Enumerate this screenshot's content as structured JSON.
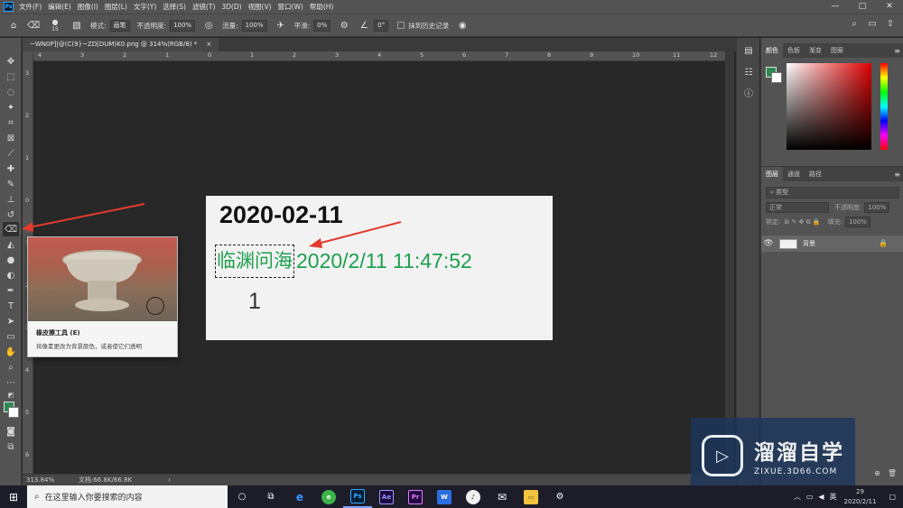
{
  "app": {
    "menu": [
      "文件(F)",
      "编辑(E)",
      "图像(I)",
      "图层(L)",
      "文字(Y)",
      "选择(S)",
      "滤镜(T)",
      "3D(D)",
      "视图(V)",
      "窗口(W)",
      "帮助(H)"
    ],
    "window_controls": [
      "—",
      "□",
      "✕"
    ]
  },
  "options_bar": {
    "brush_size": "15",
    "mode_label": "模式:",
    "mode_value": "画笔",
    "opacity_label": "不透明度:",
    "opacity_value": "100%",
    "flow_label": "流量:",
    "flow_value": "100%",
    "smoothing_label": "平滑:",
    "smoothing_value": "0%",
    "angle_value": "0°",
    "erase_history_label": "抹到历史记录"
  },
  "document": {
    "tab_title": "~WN0P]|@(C(9}~ZD[DUM)K0.png @ 314%(RGB/8) *",
    "tab_close": "×",
    "ruler_top": [
      "4",
      "3",
      "2",
      "1",
      "0",
      "1",
      "2",
      "3",
      "4",
      "5",
      "6",
      "7",
      "8",
      "9",
      "10",
      "11",
      "12"
    ],
    "ruler_left": [
      "3",
      "2",
      "1",
      "0",
      "1",
      "2",
      "3",
      "4",
      "5",
      "6"
    ],
    "image": {
      "date": "2020-02-11",
      "name": "临渊问海",
      "timestamp": "2020/2/11 11:47:52",
      "number": "1"
    }
  },
  "tooltip": {
    "title": "橡皮擦工具 (E)",
    "description": "将像素更改为背景颜色，或者使它们透明"
  },
  "color_panel": {
    "tabs": [
      "颜色",
      "色板",
      "渐变",
      "图案"
    ],
    "foreground": "#2f8a52",
    "background": "#ffffff"
  },
  "layers_panel": {
    "tabs": [
      "图层",
      "通道",
      "路径"
    ],
    "filter_placeholder": "类型",
    "blend_mode": "正常",
    "opacity_label": "不透明度:",
    "opacity_value": "100%",
    "lock_label": "锁定:",
    "fill_label": "填充:",
    "fill_value": "100%",
    "layers": [
      {
        "name": "背景"
      }
    ]
  },
  "status_bar": {
    "zoom": "313.84%",
    "doc_info": "文档:66.8K/66.8K"
  },
  "watermark": {
    "name": "溜溜自学",
    "url": "ZIXUE.3D66.COM"
  },
  "taskbar": {
    "search_placeholder": "在这里输入你要搜索的内容",
    "time": "29",
    "date": "2020/2/11",
    "ime": "英"
  }
}
